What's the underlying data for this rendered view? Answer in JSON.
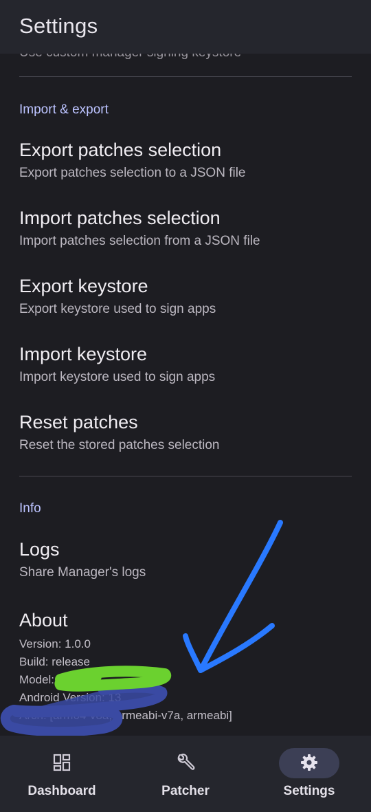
{
  "appbar": {
    "title": "Settings"
  },
  "partial_prev_text": "Use custom manager signing keystore",
  "sections": {
    "import_export": {
      "header": "Import & export",
      "items": [
        {
          "title": "Export patches selection",
          "subtitle": "Export patches selection to a JSON file"
        },
        {
          "title": "Import patches selection",
          "subtitle": "Import patches selection from a JSON file"
        },
        {
          "title": "Export keystore",
          "subtitle": "Export keystore used to sign apps"
        },
        {
          "title": "Import keystore",
          "subtitle": "Import keystore used to sign apps"
        },
        {
          "title": "Reset patches",
          "subtitle": "Reset the stored patches selection"
        }
      ]
    },
    "info": {
      "header": "Info",
      "logs": {
        "title": "Logs",
        "subtitle": "Share Manager's logs"
      },
      "about": {
        "title": "About",
        "version": "Version: 1.0.0",
        "build": "Build: release",
        "model": "Model:",
        "android_version": "Android Version: 13",
        "arch": "Arch: [arm64-v8a, armeabi-v7a, armeabi]"
      }
    }
  },
  "annotations": {
    "arrow_color": "#2979ff",
    "green_scribble_color": "#6bd12f",
    "blue_highlight_color": "#3a4aa3"
  },
  "bottom_nav": [
    {
      "label": "Dashboard",
      "icon": "dashboard-icon",
      "active": false
    },
    {
      "label": "Patcher",
      "icon": "wrench-icon",
      "active": false
    },
    {
      "label": "Settings",
      "icon": "gear-icon",
      "active": true
    }
  ]
}
